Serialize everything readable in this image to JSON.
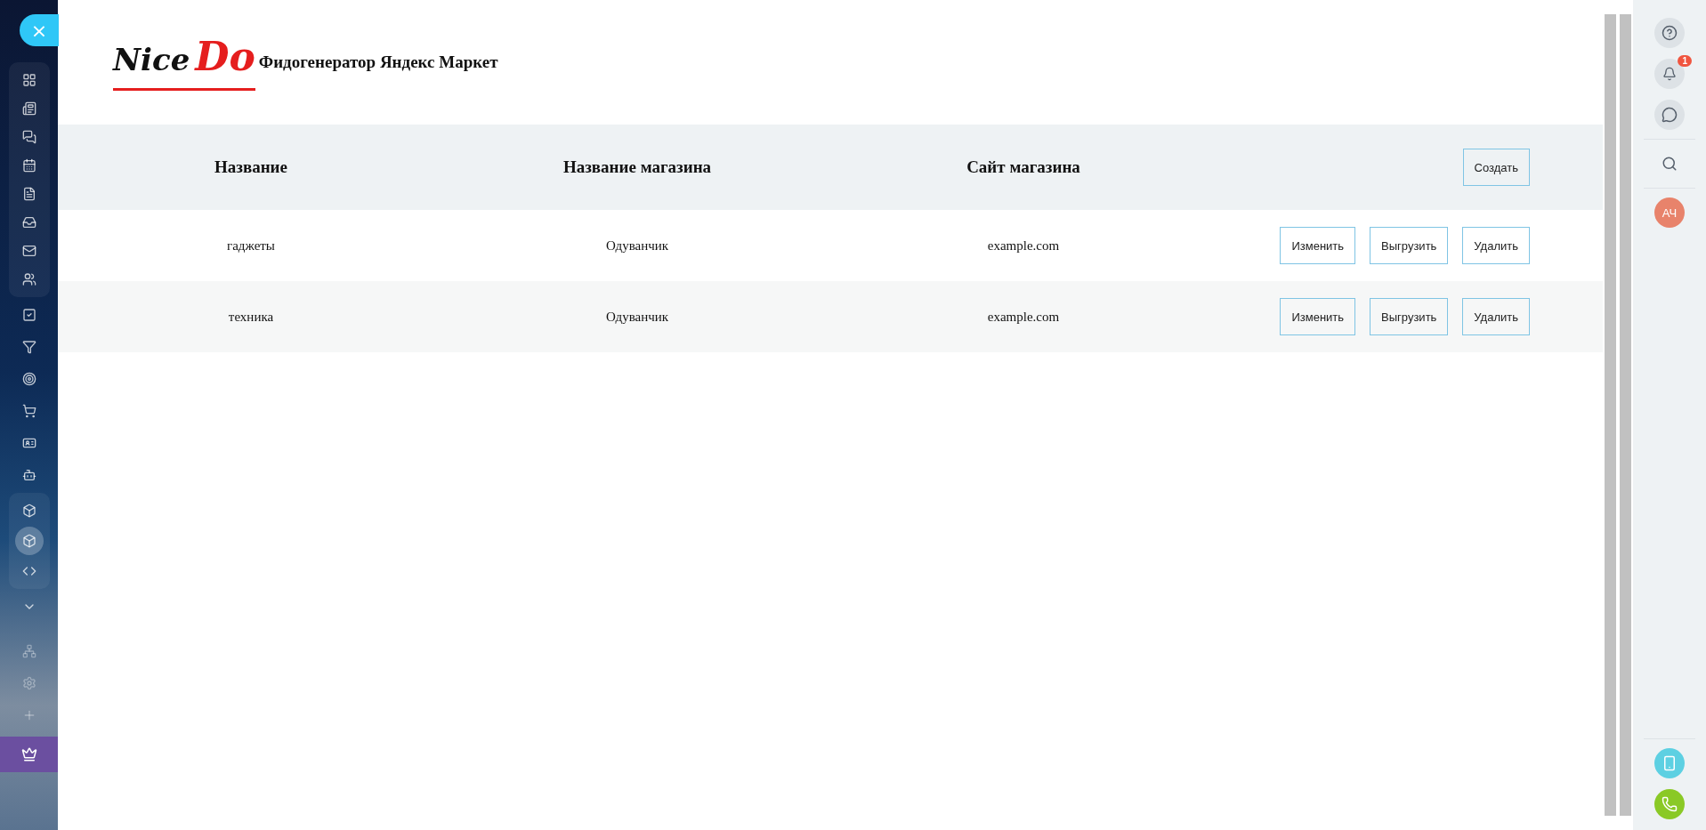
{
  "close_button": {
    "label": "×"
  },
  "logo": {
    "first": "Nice",
    "second": "Do"
  },
  "page_title": "Фидогенератор Яндекс Маркет",
  "table": {
    "columns": [
      "Название",
      "Название магазина",
      "Сайт магазина"
    ],
    "create_button": "Создать",
    "rows": [
      {
        "name": "гаджеты",
        "shop": "Одуванчик",
        "site": "example.com",
        "actions": [
          "Изменить",
          "Выгрузить",
          "Удалить"
        ]
      },
      {
        "name": "техника",
        "shop": "Одуванчик",
        "site": "example.com",
        "actions": [
          "Изменить",
          "Выгрузить",
          "Удалить"
        ]
      }
    ]
  },
  "right_panel": {
    "notification_count": "1",
    "avatar": "АЧ"
  }
}
